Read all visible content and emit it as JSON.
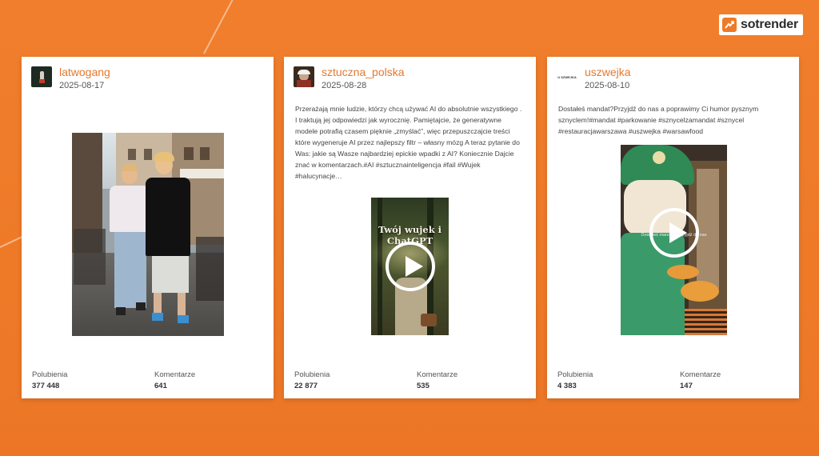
{
  "brand": {
    "name": "sotrender",
    "accent_color": "#ee7a28",
    "background_color": "#f07e2c"
  },
  "posts": [
    {
      "username": "latwogang",
      "date": "2025-08-17",
      "caption": "",
      "media_type": "photo",
      "likes_label": "Polubienia",
      "likes": "377 448",
      "comments_label": "Komentarze",
      "comments": "641"
    },
    {
      "username": "sztuczna_polska",
      "date": "2025-08-28",
      "caption": "Przerażają mnie ludzie, którzy chcą używać AI do absolutnie wszystkiego . I traktują jej odpowiedzi jak wyrocznię. Pamiętajcie, że generatywne modele potrafią czasem pięknie „zmyślać”, więc przepuszczajcie treści które wygeneruje AI przez najlepszy filtr – własny mózg A teraz pytanie do Was: jakie są Wasze najbardziej epickie wpadki z AI? Koniecznie Dajcie znać w komentarzach.#AI #sztucznainteligencja #fail #Wujek #halucynacje…",
      "media_type": "video",
      "video_overlay_text": "Twój wujek i ChatGPT",
      "likes_label": "Polubienia",
      "likes": "22 877",
      "comments_label": "Komentarze",
      "comments": "535"
    },
    {
      "username": "uszwejka",
      "date": "2025-08-10",
      "caption": "Dostałeś mandat?Przyjdź do nas a poprawimy Ci humor pysznym sznyclem!#mandat #parkowanie #sznycelzamandat #sznycel #restauracjawarszawa #uszwejka #warsawfood",
      "media_type": "video",
      "video_overlay_text": "Dostałeś mandat? Przyjdź do nas",
      "avatar_text": "U SZWEJKA",
      "likes_label": "Polubienia",
      "likes": "4 383",
      "comments_label": "Komentarze",
      "comments": "147"
    }
  ]
}
